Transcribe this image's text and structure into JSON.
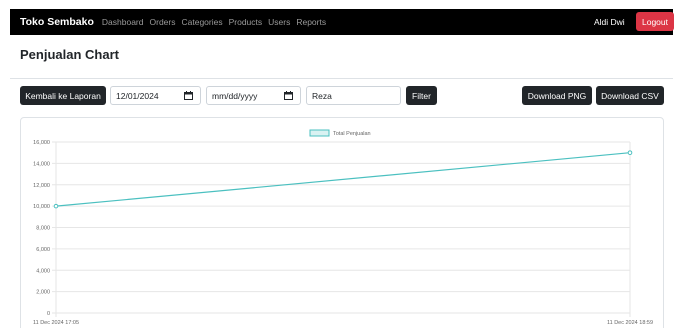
{
  "navbar": {
    "brand": "Toko Sembako",
    "links": [
      "Dashboard",
      "Orders",
      "Categories",
      "Products",
      "Users",
      "Reports"
    ],
    "user": "Aldi Dwi",
    "logout_label": "Logout"
  },
  "page": {
    "title": "Penjualan Chart"
  },
  "toolbar": {
    "back_label": "Kembali ke Laporan",
    "start_date": "12/01/2024",
    "end_date_placeholder": "mm/dd/yyyy",
    "name_filter": "Reza",
    "filter_label": "Filter",
    "download_png_label": "Download PNG",
    "download_csv_label": "Download CSV"
  },
  "colors": {
    "navbar_bg": "#000000",
    "logout_bg": "#dc3545",
    "dark_button_bg": "#212529",
    "series_line": "#4bc0c0"
  },
  "icons": {
    "date_picker": "calendar-icon"
  },
  "chart_data": {
    "type": "line",
    "x": [
      "11 Dec 2024 17:05",
      "11 Dec 2024 18:59"
    ],
    "series": [
      {
        "name": "Total Penjualan",
        "values": [
          10000,
          15000
        ]
      }
    ],
    "ylim": [
      0,
      16000
    ],
    "yticks": [
      0,
      2000,
      4000,
      6000,
      8000,
      10000,
      12000,
      14000,
      16000
    ],
    "ytick_labels": [
      "0",
      "2,000",
      "4,000",
      "6,000",
      "8,000",
      "10,000",
      "12,000",
      "14,000",
      "16,000"
    ],
    "grid": true,
    "legend": "top-center"
  }
}
